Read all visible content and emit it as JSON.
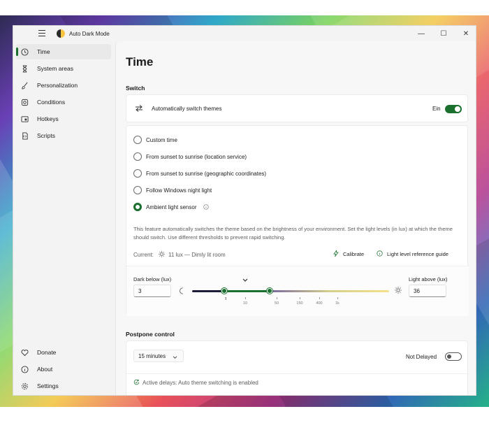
{
  "window": {
    "title": "Auto Dark Mode",
    "controls": {
      "minimize": "—",
      "maximize": "☐",
      "close": "✕"
    }
  },
  "sidebar": {
    "top_items": [
      {
        "label": "Time",
        "icon": "clock-icon"
      },
      {
        "label": "System areas",
        "icon": "hourglass-icon"
      },
      {
        "label": "Personalization",
        "icon": "brush-icon"
      },
      {
        "label": "Conditions",
        "icon": "conditions-icon"
      },
      {
        "label": "Hotkeys",
        "icon": "keyboard-icon"
      },
      {
        "label": "Scripts",
        "icon": "script-icon"
      }
    ],
    "bottom_items": [
      {
        "label": "Donate",
        "icon": "heart-icon"
      },
      {
        "label": "About",
        "icon": "info-icon"
      },
      {
        "label": "Settings",
        "icon": "gear-icon"
      }
    ]
  },
  "page": {
    "title": "Time",
    "switch_section": "Switch",
    "auto_switch": {
      "label": "Automatically switch themes",
      "state_label": "Ein",
      "on": true
    },
    "options": [
      {
        "label": "Custom time",
        "checked": false
      },
      {
        "label": "From sunset to sunrise (location service)",
        "checked": false
      },
      {
        "label": "From sunset to sunrise (geographic coordinates)",
        "checked": false
      },
      {
        "label": "Follow Windows night light",
        "checked": false
      },
      {
        "label": "Ambient light sensor",
        "checked": true
      }
    ],
    "description": "This feature automatically switches the theme based on the brightness of your environment. Set the light levels (in lux) at which the theme should switch. Use different thresholds to prevent rapid switching.",
    "current_label": "Current:",
    "current_value": "11 lux — Dimly lit room",
    "calibrate": "Calibrate",
    "reference_guide": "Light level reference guide",
    "dark_below_label": "Dark below (lux)",
    "dark_below_value": "3",
    "light_above_label": "Light above (lux)",
    "light_above_value": "36",
    "ticks": [
      "1",
      "10",
      "50",
      "150",
      "400",
      "1k"
    ],
    "postpone_section": "Postpone control",
    "postpone_dropdown": "15 minutes",
    "not_delayed_label": "Not Delayed",
    "not_delayed_on": false,
    "active_delays": "Active delays: Auto theme switching is enabled"
  },
  "colors": {
    "accent": "#1a6e2e",
    "sidebar_bg": "#f3f3f3",
    "content_bg": "#f7f7f7",
    "card_bg": "#ffffff"
  }
}
